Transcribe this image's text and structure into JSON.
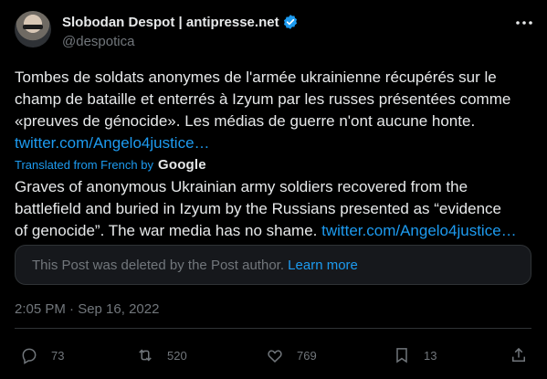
{
  "author": {
    "display_name": "Slobodan Despot | antipresse.net",
    "handle": "@despotica",
    "verified": true
  },
  "post": {
    "original_line1": "Tombes de soldats anonymes de l'armée ukrainienne récupérés sur le",
    "original_line2": "champ de bataille et enterrés à Izyum par les russes présentées comme",
    "original_line3": "«preuves de génocide». Les médias de guerre n'ont aucune honte.",
    "original_link": "twitter.com/Angelo4justice…",
    "translated_from": "Translated from French by",
    "translator": "Google",
    "translated_line1": "Graves of anonymous Ukrainian army soldiers recovered from the",
    "translated_line2": "battlefield and buried in Izyum by the Russians presented as “evidence",
    "translated_line3": "of genocide”. The war media has no shame. ",
    "translated_link": "twitter.com/Angelo4justice…",
    "deleted_notice": "This Post was deleted by the Post author. ",
    "learn_more": "Learn more",
    "timestamp": "2:05 PM · Sep 16, 2022"
  },
  "actions": {
    "replies": "73",
    "reposts": "520",
    "likes": "769",
    "bookmarks": "13"
  },
  "colors": {
    "background": "#000000",
    "link": "#1d9bf0",
    "muted": "#71767b",
    "text": "#e7e9ea"
  }
}
